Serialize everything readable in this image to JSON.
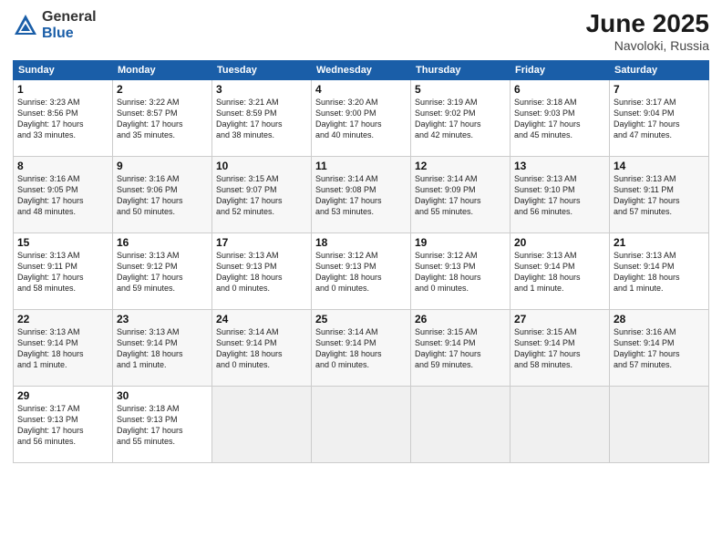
{
  "logo": {
    "general": "General",
    "blue": "Blue"
  },
  "title": "June 2025",
  "location": "Navoloki, Russia",
  "weekdays": [
    "Sunday",
    "Monday",
    "Tuesday",
    "Wednesday",
    "Thursday",
    "Friday",
    "Saturday"
  ],
  "weeks": [
    [
      {
        "day": "1",
        "info": "Sunrise: 3:23 AM\nSunset: 8:56 PM\nDaylight: 17 hours\nand 33 minutes."
      },
      {
        "day": "2",
        "info": "Sunrise: 3:22 AM\nSunset: 8:57 PM\nDaylight: 17 hours\nand 35 minutes."
      },
      {
        "day": "3",
        "info": "Sunrise: 3:21 AM\nSunset: 8:59 PM\nDaylight: 17 hours\nand 38 minutes."
      },
      {
        "day": "4",
        "info": "Sunrise: 3:20 AM\nSunset: 9:00 PM\nDaylight: 17 hours\nand 40 minutes."
      },
      {
        "day": "5",
        "info": "Sunrise: 3:19 AM\nSunset: 9:02 PM\nDaylight: 17 hours\nand 42 minutes."
      },
      {
        "day": "6",
        "info": "Sunrise: 3:18 AM\nSunset: 9:03 PM\nDaylight: 17 hours\nand 45 minutes."
      },
      {
        "day": "7",
        "info": "Sunrise: 3:17 AM\nSunset: 9:04 PM\nDaylight: 17 hours\nand 47 minutes."
      }
    ],
    [
      {
        "day": "8",
        "info": "Sunrise: 3:16 AM\nSunset: 9:05 PM\nDaylight: 17 hours\nand 48 minutes."
      },
      {
        "day": "9",
        "info": "Sunrise: 3:16 AM\nSunset: 9:06 PM\nDaylight: 17 hours\nand 50 minutes."
      },
      {
        "day": "10",
        "info": "Sunrise: 3:15 AM\nSunset: 9:07 PM\nDaylight: 17 hours\nand 52 minutes."
      },
      {
        "day": "11",
        "info": "Sunrise: 3:14 AM\nSunset: 9:08 PM\nDaylight: 17 hours\nand 53 minutes."
      },
      {
        "day": "12",
        "info": "Sunrise: 3:14 AM\nSunset: 9:09 PM\nDaylight: 17 hours\nand 55 minutes."
      },
      {
        "day": "13",
        "info": "Sunrise: 3:13 AM\nSunset: 9:10 PM\nDaylight: 17 hours\nand 56 minutes."
      },
      {
        "day": "14",
        "info": "Sunrise: 3:13 AM\nSunset: 9:11 PM\nDaylight: 17 hours\nand 57 minutes."
      }
    ],
    [
      {
        "day": "15",
        "info": "Sunrise: 3:13 AM\nSunset: 9:11 PM\nDaylight: 17 hours\nand 58 minutes."
      },
      {
        "day": "16",
        "info": "Sunrise: 3:13 AM\nSunset: 9:12 PM\nDaylight: 17 hours\nand 59 minutes."
      },
      {
        "day": "17",
        "info": "Sunrise: 3:13 AM\nSunset: 9:13 PM\nDaylight: 18 hours\nand 0 minutes."
      },
      {
        "day": "18",
        "info": "Sunrise: 3:12 AM\nSunset: 9:13 PM\nDaylight: 18 hours\nand 0 minutes."
      },
      {
        "day": "19",
        "info": "Sunrise: 3:12 AM\nSunset: 9:13 PM\nDaylight: 18 hours\nand 0 minutes."
      },
      {
        "day": "20",
        "info": "Sunrise: 3:13 AM\nSunset: 9:14 PM\nDaylight: 18 hours\nand 1 minute."
      },
      {
        "day": "21",
        "info": "Sunrise: 3:13 AM\nSunset: 9:14 PM\nDaylight: 18 hours\nand 1 minute."
      }
    ],
    [
      {
        "day": "22",
        "info": "Sunrise: 3:13 AM\nSunset: 9:14 PM\nDaylight: 18 hours\nand 1 minute."
      },
      {
        "day": "23",
        "info": "Sunrise: 3:13 AM\nSunset: 9:14 PM\nDaylight: 18 hours\nand 1 minute."
      },
      {
        "day": "24",
        "info": "Sunrise: 3:14 AM\nSunset: 9:14 PM\nDaylight: 18 hours\nand 0 minutes."
      },
      {
        "day": "25",
        "info": "Sunrise: 3:14 AM\nSunset: 9:14 PM\nDaylight: 18 hours\nand 0 minutes."
      },
      {
        "day": "26",
        "info": "Sunrise: 3:15 AM\nSunset: 9:14 PM\nDaylight: 17 hours\nand 59 minutes."
      },
      {
        "day": "27",
        "info": "Sunrise: 3:15 AM\nSunset: 9:14 PM\nDaylight: 17 hours\nand 58 minutes."
      },
      {
        "day": "28",
        "info": "Sunrise: 3:16 AM\nSunset: 9:14 PM\nDaylight: 17 hours\nand 57 minutes."
      }
    ],
    [
      {
        "day": "29",
        "info": "Sunrise: 3:17 AM\nSunset: 9:13 PM\nDaylight: 17 hours\nand 56 minutes."
      },
      {
        "day": "30",
        "info": "Sunrise: 3:18 AM\nSunset: 9:13 PM\nDaylight: 17 hours\nand 55 minutes."
      },
      {
        "day": "",
        "info": ""
      },
      {
        "day": "",
        "info": ""
      },
      {
        "day": "",
        "info": ""
      },
      {
        "day": "",
        "info": ""
      },
      {
        "day": "",
        "info": ""
      }
    ]
  ]
}
